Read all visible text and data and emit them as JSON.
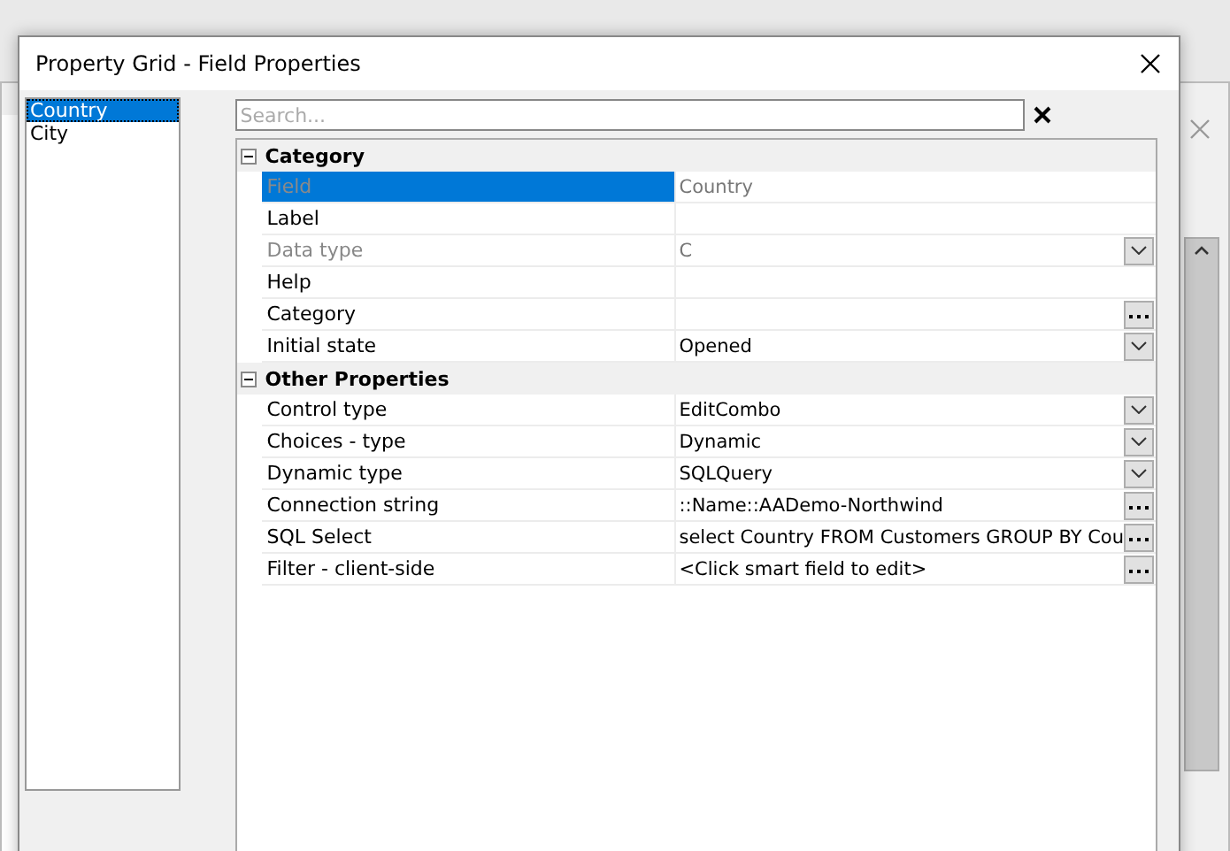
{
  "window": {
    "title": "Property Grid  - Field Properties"
  },
  "fields_list": [
    {
      "label": "Country",
      "selected": true
    },
    {
      "label": "City",
      "selected": false
    }
  ],
  "search": {
    "placeholder": "Search..."
  },
  "categories": [
    {
      "name": "Category",
      "expanded": true,
      "rows": [
        {
          "label": "Field",
          "value": "Country",
          "kind": "text",
          "disabled": true,
          "selected": true
        },
        {
          "label": "Label",
          "value": "",
          "kind": "text",
          "disabled": false,
          "selected": false
        },
        {
          "label": "Data type",
          "value": "C",
          "kind": "dropdown",
          "disabled": true,
          "selected": false
        },
        {
          "label": "Help",
          "value": "",
          "kind": "text",
          "disabled": false,
          "selected": false
        },
        {
          "label": "Category",
          "value": "",
          "kind": "ellipsis",
          "disabled": false,
          "selected": false
        },
        {
          "label": "Initial state",
          "value": "Opened",
          "kind": "dropdown",
          "disabled": false,
          "selected": false
        }
      ]
    },
    {
      "name": "Other Properties",
      "expanded": true,
      "rows": [
        {
          "label": "Control type",
          "value": "EditCombo",
          "kind": "dropdown",
          "disabled": false,
          "selected": false
        },
        {
          "label": "Choices - type",
          "value": "Dynamic",
          "kind": "dropdown",
          "disabled": false,
          "selected": false
        },
        {
          "label": "Dynamic type",
          "value": "SQLQuery",
          "kind": "dropdown",
          "disabled": false,
          "selected": false
        },
        {
          "label": "Connection string",
          "value": "::Name::AADemo-Northwind",
          "kind": "ellipsis",
          "disabled": false,
          "selected": false
        },
        {
          "label": "SQL Select",
          "value": "select Country FROM Customers GROUP BY Cou",
          "kind": "ellipsis",
          "disabled": false,
          "selected": false
        },
        {
          "label": "Filter - client-side",
          "value": "<Click smart field to edit>",
          "kind": "ellipsis",
          "disabled": false,
          "selected": false
        }
      ]
    }
  ]
}
